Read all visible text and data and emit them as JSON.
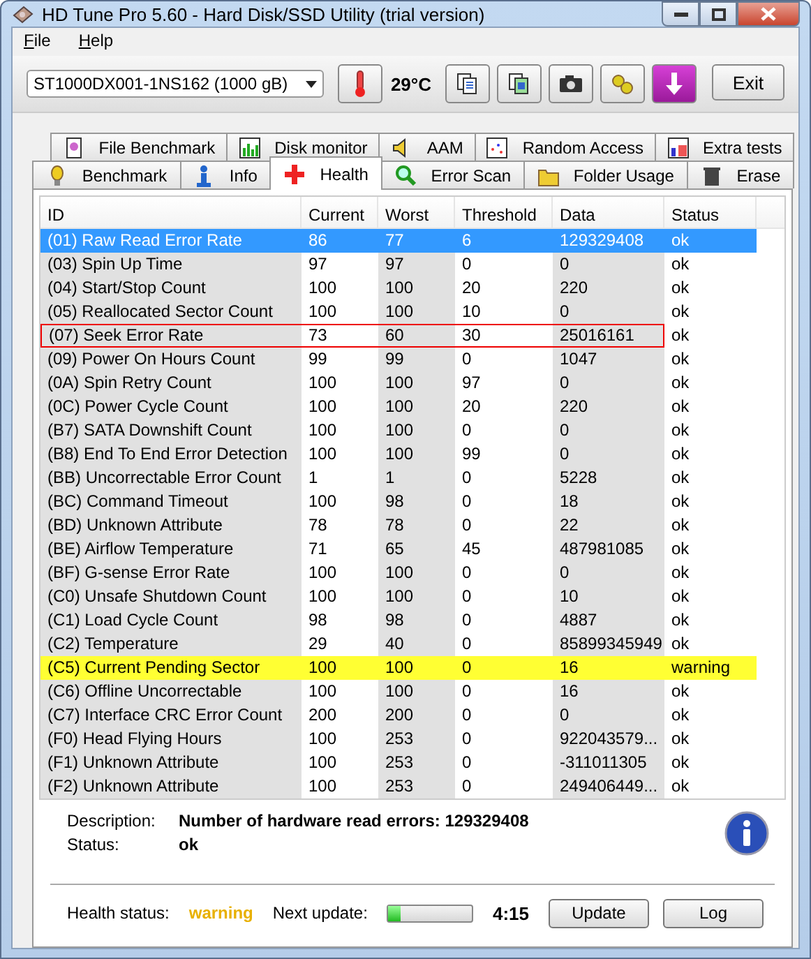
{
  "window": {
    "title": "HD Tune Pro 5.60 - Hard Disk/SSD Utility (trial version)"
  },
  "menu": [
    "File",
    "Help"
  ],
  "toolbar": {
    "drive": "ST1000DX001-1NS162 (1000 gB)",
    "temperature": "29°C",
    "exit": "Exit"
  },
  "tabs_top": [
    {
      "label": "File Benchmark",
      "selected": false
    },
    {
      "label": "Disk monitor",
      "selected": false
    },
    {
      "label": "AAM",
      "selected": false
    },
    {
      "label": "Random Access",
      "selected": false
    },
    {
      "label": "Extra tests",
      "selected": false
    }
  ],
  "tabs_bottom": [
    {
      "label": "Benchmark",
      "selected": false
    },
    {
      "label": "Info",
      "selected": false
    },
    {
      "label": "Health",
      "selected": true
    },
    {
      "label": "Error Scan",
      "selected": false
    },
    {
      "label": "Folder Usage",
      "selected": false
    },
    {
      "label": "Erase",
      "selected": false
    }
  ],
  "table": {
    "columns": [
      "ID",
      "Current",
      "Worst",
      "Threshold",
      "Data",
      "Status"
    ],
    "rows": [
      {
        "cells": [
          "(01) Raw Read Error Rate",
          "86",
          "77",
          "6",
          "129329408",
          "ok"
        ],
        "selected": true,
        "warning": false,
        "outlined": false
      },
      {
        "cells": [
          "(03) Spin Up Time",
          "97",
          "97",
          "0",
          "0",
          "ok"
        ],
        "selected": false,
        "warning": false,
        "outlined": false
      },
      {
        "cells": [
          "(04) Start/Stop Count",
          "100",
          "100",
          "20",
          "220",
          "ok"
        ],
        "selected": false,
        "warning": false,
        "outlined": false
      },
      {
        "cells": [
          "(05) Reallocated Sector Count",
          "100",
          "100",
          "10",
          "0",
          "ok"
        ],
        "selected": false,
        "warning": false,
        "outlined": false
      },
      {
        "cells": [
          "(07) Seek Error Rate",
          "73",
          "60",
          "30",
          "25016161",
          "ok"
        ],
        "selected": false,
        "warning": false,
        "outlined": true
      },
      {
        "cells": [
          "(09) Power On Hours Count",
          "99",
          "99",
          "0",
          "1047",
          "ok"
        ],
        "selected": false,
        "warning": false,
        "outlined": false
      },
      {
        "cells": [
          "(0A) Spin Retry Count",
          "100",
          "100",
          "97",
          "0",
          "ok"
        ],
        "selected": false,
        "warning": false,
        "outlined": false
      },
      {
        "cells": [
          "(0C) Power Cycle Count",
          "100",
          "100",
          "20",
          "220",
          "ok"
        ],
        "selected": false,
        "warning": false,
        "outlined": false
      },
      {
        "cells": [
          "(B7) SATA Downshift Count",
          "100",
          "100",
          "0",
          "0",
          "ok"
        ],
        "selected": false,
        "warning": false,
        "outlined": false
      },
      {
        "cells": [
          "(B8) End To End Error Detection",
          "100",
          "100",
          "99",
          "0",
          "ok"
        ],
        "selected": false,
        "warning": false,
        "outlined": false
      },
      {
        "cells": [
          "(BB) Uncorrectable Error Count",
          "1",
          "1",
          "0",
          "5228",
          "ok"
        ],
        "selected": false,
        "warning": false,
        "outlined": false
      },
      {
        "cells": [
          "(BC) Command Timeout",
          "100",
          "98",
          "0",
          "18",
          "ok"
        ],
        "selected": false,
        "warning": false,
        "outlined": false
      },
      {
        "cells": [
          "(BD) Unknown Attribute",
          "78",
          "78",
          "0",
          "22",
          "ok"
        ],
        "selected": false,
        "warning": false,
        "outlined": false
      },
      {
        "cells": [
          "(BE) Airflow Temperature",
          "71",
          "65",
          "45",
          "487981085",
          "ok"
        ],
        "selected": false,
        "warning": false,
        "outlined": false
      },
      {
        "cells": [
          "(BF) G-sense Error Rate",
          "100",
          "100",
          "0",
          "0",
          "ok"
        ],
        "selected": false,
        "warning": false,
        "outlined": false
      },
      {
        "cells": [
          "(C0) Unsafe Shutdown Count",
          "100",
          "100",
          "0",
          "10",
          "ok"
        ],
        "selected": false,
        "warning": false,
        "outlined": false
      },
      {
        "cells": [
          "(C1) Load Cycle Count",
          "98",
          "98",
          "0",
          "4887",
          "ok"
        ],
        "selected": false,
        "warning": false,
        "outlined": false
      },
      {
        "cells": [
          "(C2) Temperature",
          "29",
          "40",
          "0",
          "85899345949",
          "ok"
        ],
        "selected": false,
        "warning": false,
        "outlined": false
      },
      {
        "cells": [
          "(C5) Current Pending Sector",
          "100",
          "100",
          "0",
          "16",
          "warning"
        ],
        "selected": false,
        "warning": true,
        "outlined": false
      },
      {
        "cells": [
          "(C6) Offline Uncorrectable",
          "100",
          "100",
          "0",
          "16",
          "ok"
        ],
        "selected": false,
        "warning": false,
        "outlined": false
      },
      {
        "cells": [
          "(C7) Interface CRC Error Count",
          "200",
          "200",
          "0",
          "0",
          "ok"
        ],
        "selected": false,
        "warning": false,
        "outlined": false
      },
      {
        "cells": [
          "(F0) Head Flying Hours",
          "100",
          "253",
          "0",
          "922043579...",
          "ok"
        ],
        "selected": false,
        "warning": false,
        "outlined": false
      },
      {
        "cells": [
          "(F1) Unknown Attribute",
          "100",
          "253",
          "0",
          "-311011305",
          "ok"
        ],
        "selected": false,
        "warning": false,
        "outlined": false
      },
      {
        "cells": [
          "(F2) Unknown Attribute",
          "100",
          "253",
          "0",
          "249406449...",
          "ok"
        ],
        "selected": false,
        "warning": false,
        "outlined": false
      }
    ]
  },
  "details": {
    "description_label": "Description:",
    "description": "Number of hardware read errors: 129329408",
    "status_label": "Status:",
    "status": "ok"
  },
  "footer": {
    "health_label": "Health status:",
    "health": "warning",
    "next_update_label": "Next update:",
    "level": 0.15,
    "time": "4:15",
    "buttons": [
      "Update",
      "Log"
    ]
  }
}
